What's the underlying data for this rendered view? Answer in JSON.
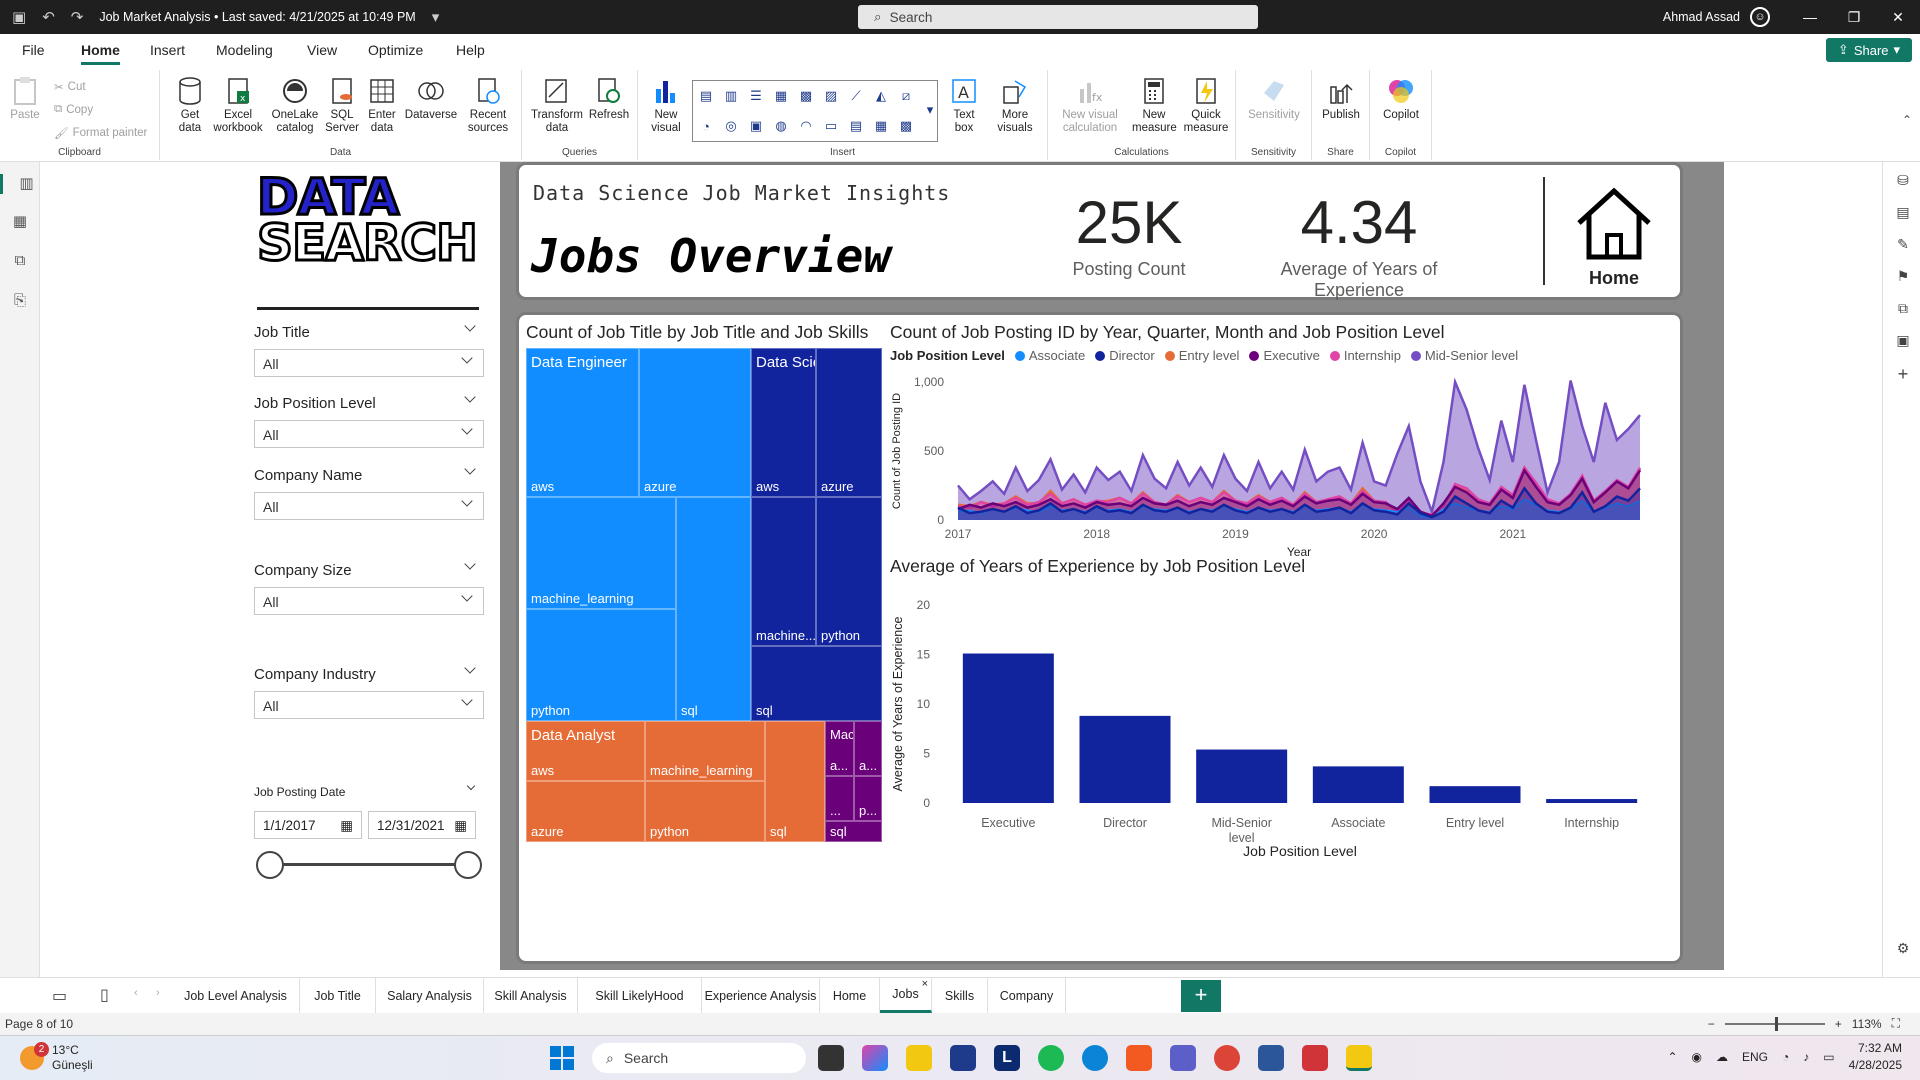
{
  "titlebar": {
    "title": "Job Market Analysis • Last saved: 4/21/2025 at 10:49 PM",
    "search_placeholder": "Search",
    "user": "Ahmad Assad"
  },
  "menu": {
    "items": [
      "File",
      "Home",
      "Insert",
      "Modeling",
      "View",
      "Optimize",
      "Help"
    ],
    "active": "Home",
    "share": "Share"
  },
  "ribbon": {
    "clipboard": {
      "group": "Clipboard",
      "paste": "Paste",
      "cut": "Cut",
      "copy": "Copy",
      "format_painter": "Format painter"
    },
    "data": {
      "group": "Data",
      "get_data": "Get data",
      "excel": "Excel workbook",
      "onelake": "OneLake catalog",
      "sql": "SQL Server",
      "enter": "Enter data",
      "dataverse": "Dataverse",
      "recent": "Recent sources"
    },
    "queries": {
      "group": "Queries",
      "transform": "Transform data",
      "refresh": "Refresh"
    },
    "insert": {
      "group": "Insert",
      "new_visual": "New visual",
      "text_box": "Text box",
      "more_visuals": "More visuals"
    },
    "calculations": {
      "group": "Calculations",
      "new_visual_calc": "New visual calculation",
      "new_measure": "New measure",
      "quick_measure": "Quick measure"
    },
    "sensitivity": {
      "group": "Sensitivity",
      "label": "Sensitivity"
    },
    "share": {
      "group": "Share",
      "publish": "Publish"
    },
    "copilot": {
      "group": "Copilot",
      "label": "Copilot"
    }
  },
  "slicers": {
    "logo_line1": "DATA",
    "logo_line2": "SEARCH",
    "items": [
      {
        "title": "Job Title",
        "value": "All"
      },
      {
        "title": "Job Position Level",
        "value": "All"
      },
      {
        "title": "Company Name",
        "value": "All"
      },
      {
        "title": "Company Size",
        "value": "All"
      },
      {
        "title": "Company Industry",
        "value": "All"
      }
    ],
    "date": {
      "title": "Job Posting Date",
      "start": "1/1/2017",
      "end": "12/31/2021"
    }
  },
  "header": {
    "subtitle": "Data Science Job Market Insights",
    "title": "Jobs Overview",
    "kpi1_value": "25K",
    "kpi1_label": "Posting Count",
    "kpi2_value": "4.34",
    "kpi2_label": "Average of Years of Experience",
    "home_label": "Home"
  },
  "chart_data": [
    {
      "type": "treemap",
      "title": "Count of Job Title by Job Title and Job Skills",
      "groups": [
        {
          "name": "Data Engineer",
          "color": "#118dff",
          "children": [
            "aws",
            "azure",
            "machine_learning",
            "python",
            "sql"
          ]
        },
        {
          "name": "Data Scientist",
          "color": "#12239e",
          "children": [
            "aws",
            "azure",
            "machine...",
            "python",
            "sql"
          ]
        },
        {
          "name": "Data Analyst",
          "color": "#e66c37",
          "children": [
            "aws",
            "machine_learning",
            "azure",
            "python",
            "sql"
          ]
        },
        {
          "name": "Machi...",
          "color": "#6b007b",
          "children": [
            "a...",
            "a...",
            "...",
            "p...",
            "sql"
          ]
        }
      ]
    },
    {
      "type": "area",
      "title": "Count of Job Posting ID by Year, Quarter, Month and Job Position Level",
      "legend_title": "Job Position Level",
      "xlabel": "Year",
      "ylabel": "Count of Job Posting ID",
      "x_ticks": [
        "2017",
        "2018",
        "2019",
        "2020",
        "2021"
      ],
      "y_ticks": [
        "0",
        "500",
        "1,000"
      ],
      "ylim": [
        0,
        1000
      ],
      "series": [
        {
          "name": "Associate",
          "color": "#118dff",
          "values": [
            60,
            70,
            50,
            80,
            60,
            90,
            70,
            60,
            100,
            70,
            80,
            60,
            90,
            70,
            80,
            60,
            100,
            80,
            70,
            90,
            60,
            80,
            70,
            100,
            80,
            60,
            90,
            70,
            80,
            60,
            100,
            70,
            80,
            90,
            60,
            110,
            80,
            70,
            60,
            90,
            30,
            20,
            80,
            120,
            90,
            70,
            60,
            100,
            80,
            150,
            110,
            70,
            60,
            80,
            140,
            60,
            90,
            120,
            100,
            140
          ]
        },
        {
          "name": "Director",
          "color": "#12239e",
          "values": [
            90,
            50,
            60,
            80,
            60,
            100,
            50,
            70,
            120,
            60,
            80,
            50,
            100,
            60,
            70,
            50,
            110,
            70,
            60,
            90,
            50,
            80,
            60,
            110,
            70,
            50,
            90,
            60,
            80,
            50,
            110,
            60,
            70,
            90,
            50,
            120,
            70,
            60,
            40,
            120,
            50,
            20,
            60,
            170,
            120,
            70,
            50,
            140,
            90,
            230,
            120,
            60,
            50,
            90,
            200,
            60,
            100,
            170,
            140,
            230
          ]
        },
        {
          "name": "Entry level",
          "color": "#e66c37",
          "values": [
            110,
            100,
            130,
            110,
            120,
            170,
            120,
            120,
            210,
            120,
            150,
            110,
            130,
            140,
            160,
            120,
            200,
            130,
            110,
            180,
            130,
            160,
            130,
            210,
            140,
            120,
            180,
            130,
            160,
            110,
            200,
            130,
            150,
            170,
            120,
            230,
            140,
            120,
            60,
            150,
            60,
            30,
            110,
            250,
            220,
            140,
            110,
            230,
            170,
            380,
            260,
            140,
            110,
            180,
            320,
            130,
            200,
            280,
            230,
            370
          ]
        },
        {
          "name": "Executive",
          "color": "#6b007b",
          "values": [
            80,
            110,
            90,
            120,
            100,
            130,
            90,
            110,
            150,
            100,
            120,
            90,
            130,
            110,
            120,
            100,
            160,
            120,
            110,
            140,
            100,
            130,
            110,
            160,
            130,
            100,
            150,
            110,
            140,
            100,
            170,
            120,
            140,
            150,
            110,
            190,
            130,
            120,
            80,
            160,
            60,
            30,
            120,
            240,
            200,
            130,
            110,
            220,
            160,
            360,
            240,
            130,
            110,
            180,
            300,
            130,
            200,
            280,
            230,
            360
          ]
        },
        {
          "name": "Internship",
          "color": "#e044a7",
          "values": [
            100,
            90,
            130,
            100,
            120,
            160,
            110,
            130,
            190,
            120,
            150,
            110,
            140,
            130,
            160,
            120,
            190,
            130,
            110,
            170,
            130,
            160,
            130,
            200,
            140,
            120,
            170,
            130,
            160,
            110,
            190,
            130,
            150,
            170,
            120,
            210,
            140,
            130,
            60,
            140,
            50,
            40,
            100,
            260,
            230,
            150,
            120,
            240,
            180,
            380,
            270,
            150,
            120,
            190,
            320,
            140,
            210,
            290,
            240,
            380
          ]
        },
        {
          "name": "Mid-Senior level",
          "color": "#744ec2",
          "values": [
            250,
            150,
            210,
            280,
            190,
            380,
            210,
            290,
            440,
            220,
            330,
            200,
            380,
            290,
            350,
            210,
            470,
            300,
            230,
            420,
            250,
            380,
            240,
            470,
            300,
            210,
            420,
            230,
            350,
            220,
            510,
            280,
            350,
            380,
            220,
            560,
            280,
            250,
            480,
            680,
            280,
            60,
            420,
            1000,
            800,
            520,
            290,
            720,
            420,
            980,
            580,
            200,
            420,
            1010,
            680,
            420,
            850,
            580,
            660,
            760
          ]
        }
      ]
    },
    {
      "type": "bar",
      "title": "Average of Years of Experience by Job Position Level",
      "xlabel": "Job Position Level",
      "ylabel": "Average of Years of Experience",
      "categories": [
        "Executive",
        "Director",
        "Mid-Senior level",
        "Associate",
        "Entry level",
        "Internship"
      ],
      "values": [
        15.1,
        8.8,
        5.4,
        3.7,
        1.7,
        0.4
      ],
      "ylim": [
        0,
        20
      ],
      "y_ticks": [
        "0",
        "5",
        "10",
        "15",
        "20"
      ],
      "color": "#12239e"
    }
  ],
  "pages": {
    "tabs": [
      "Job Level Analysis",
      "Job Title",
      "Salary Analysis",
      "Skill Analysis",
      "Skill LikelyHood",
      "Experience Analysis",
      "Home",
      "Jobs",
      "Skills",
      "Company"
    ],
    "active": "Jobs",
    "indicator": "Page 8 of 10",
    "zoom": "113%"
  },
  "taskbar": {
    "temp": "13°C",
    "weather": "Güneşli",
    "badge": "2",
    "search": "Search",
    "lang": "ENG",
    "time": "7:32 AM",
    "date": "4/28/2025"
  }
}
